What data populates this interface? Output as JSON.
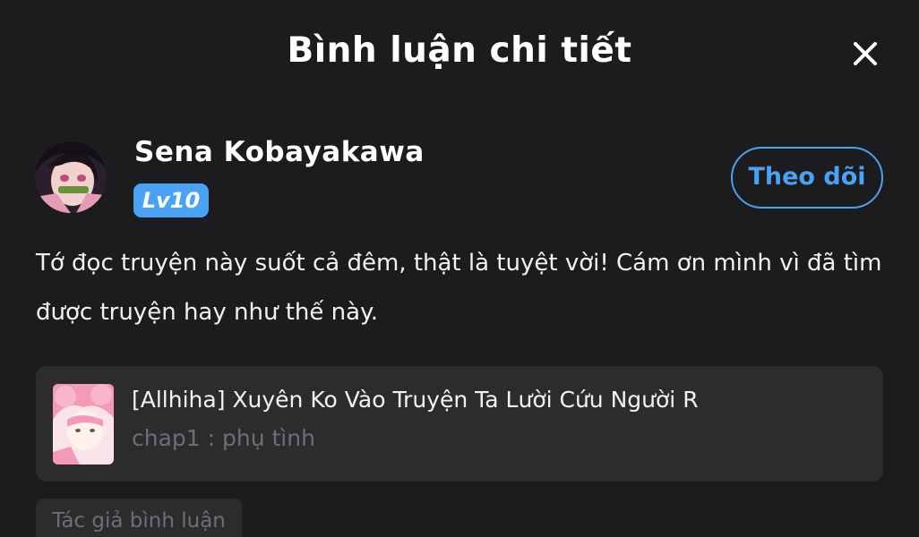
{
  "header": {
    "title": "Bình luận chi tiết",
    "close_icon": "close-icon"
  },
  "user": {
    "name": "Sena Kobayakawa",
    "level": "Lv10",
    "avatar_icon": "avatar",
    "follow_label": "Theo dõi"
  },
  "comment": {
    "text": "Tớ đọc truyện này suốt cả đêm, thật là tuyệt vời! Cám ơn mình vì đã tìm được truyện hay như thế này."
  },
  "story": {
    "title": "[Allhiha] Xuyên Ko Vào Truyện Ta Lười Cứu Người R",
    "chapter": "chap1 : phụ tình",
    "cover_icon": "story-cover"
  },
  "tags": {
    "author_comment": "Tác giả bình luận"
  },
  "colors": {
    "background": "#1c1c1e",
    "card": "#2c2c2e",
    "accent": "#4aa2f5",
    "muted_text": "#6e6e73"
  }
}
